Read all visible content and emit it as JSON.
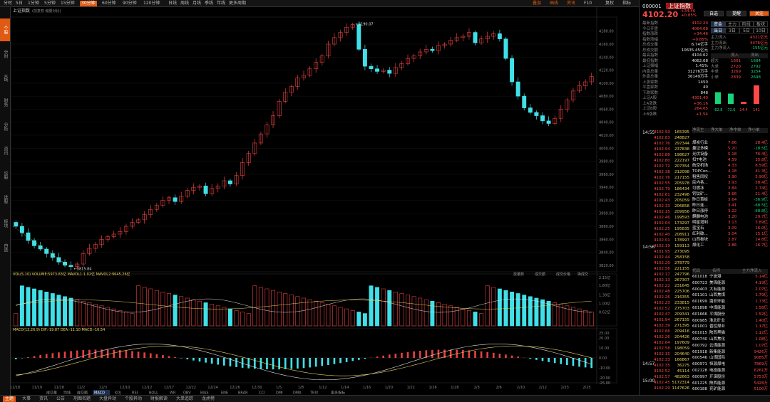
{
  "periods": [
    "分时",
    "5日",
    "1分钟",
    "5分钟",
    "15分钟",
    "30分钟",
    "60分钟",
    "90分钟",
    "120分钟",
    "日线",
    "周线",
    "月线",
    "季线",
    "年线",
    "更多周期"
  ],
  "period_active": 5,
  "toolbar_right": [
    "叠加",
    "画线",
    "资讯",
    "F10",
    "复权",
    "指标",
    "工具"
  ],
  "left_tabs": [
    "个股",
    "分时",
    "K线",
    "财务",
    "分析",
    "资讯",
    "论股",
    "选股",
    "板块",
    "自选"
  ],
  "chart": {
    "title": "上证指数",
    "legend": "(前复权 缩量对比)",
    "high_label": "4190.07",
    "low_label": "3815.84",
    "price_ticks": [
      "4180.00",
      "4160.00",
      "4140.00",
      "4120.00",
      "4100.00",
      "4080.00",
      "4060.00",
      "4040.00",
      "4020.00",
      "4000.00",
      "3980.00",
      "3960.00",
      "3940.00",
      "3920.00",
      "3900.00",
      "3880.00",
      "3860.00",
      "3840.00",
      "3820.00"
    ],
    "vol_legend": "VOL(5,10) VOLUME:5973.83亿 MAVOL1:1.02亿 MAVOL2:9645.26亿",
    "vol_ticks": [
      "2.15亿",
      "1.80亿",
      "1.38亿",
      "1.00亿",
      "0.62亿"
    ],
    "macd_legend": "MACD(12,26,9) DIF:-19.87 DEA:-11.10 MACD:-16.54",
    "macd_ticks": [
      "25.00",
      "20.00",
      "10.00",
      "0.00",
      "-10.00",
      "-20.00",
      "-25.00"
    ],
    "date_ticks": [
      "11/18",
      "11/19",
      "11/28",
      "12/2",
      "12/3",
      "12/10",
      "12/12",
      "12/17",
      "12/22",
      "12/24",
      "12/26",
      "12/30",
      "1/5",
      "1/8",
      "1/12",
      "1/14",
      "1/16",
      "1/20",
      "1/22",
      "1/26",
      "1/28",
      "2/3",
      "2/6",
      "2/10",
      "2/12",
      "2/23",
      "2/25"
    ],
    "vol_buttons": [
      "放量数",
      "成交额",
      "成交价格",
      "换成交"
    ]
  },
  "chart_data": {
    "type": "line",
    "title": "上证指数",
    "ylim": [
      3810,
      4195
    ],
    "high": 4190.07,
    "low": 3815.84,
    "close": [
      3880,
      3870,
      3858,
      3850,
      3845,
      3838,
      3832,
      3825,
      3820,
      3818,
      3822,
      3838,
      3846,
      3852,
      3860,
      3864,
      3868,
      3872,
      3880,
      3886,
      3890,
      3898,
      3906,
      3912,
      3920,
      3924,
      3918,
      3926,
      3935,
      3940,
      3942,
      3930,
      3938,
      3942,
      3950,
      3945,
      3958,
      3978,
      3992,
      4008,
      4022,
      4036,
      4050,
      4072,
      4086,
      4095,
      4108,
      4112,
      4122,
      4132,
      4142,
      4160,
      4170,
      4178,
      4186,
      4190,
      4152,
      4126,
      4122,
      4118,
      4120,
      4115,
      4124,
      4130,
      4138,
      4142,
      4148,
      4152,
      4150,
      4158,
      4160,
      4166,
      4170,
      4172,
      4178,
      4162,
      4168,
      4172,
      4176,
      4168,
      4138,
      4102,
      4080,
      4062,
      4055,
      4050,
      4042,
      4038,
      4046,
      4060,
      4074,
      4088,
      4096,
      4102,
      4110
    ]
  },
  "quote": {
    "code": "000001",
    "name": "上证指数",
    "price": "4102.20",
    "change": "+34.46",
    "pct": "+0.85%",
    "buttons": [
      "自选",
      "提醒",
      "关注"
    ],
    "stats": [
      [
        "最新指数",
        "4102.20"
      ],
      [
        "今日开盘",
        "4064.68"
      ],
      [
        "指数涨跌",
        "+34.46"
      ],
      [
        "指数涨幅",
        "+0.85%"
      ],
      [
        "总成交量",
        "6.74亿手"
      ],
      [
        "总成交额",
        "10635.45亿元"
      ],
      [
        "最高指数",
        "4104.62"
      ],
      [
        "最低指数",
        "4062.68"
      ],
      [
        "上证振幅",
        "1.41%"
      ],
      [
        "内盘总量",
        "31276万手"
      ],
      [
        "外盘总量",
        "36149万手"
      ],
      [
        "上涨家数",
        "1450"
      ],
      [
        "平盘家数",
        "40"
      ],
      [
        "下跌家数",
        "848"
      ],
      [
        "上证A股",
        "4301.40"
      ],
      [
        "上A涨跌",
        "+36.16"
      ],
      [
        "上证B股",
        "264.65"
      ],
      [
        "上B涨跌",
        "+1.54"
      ]
    ],
    "fund_tabs": [
      "资金",
      "主力",
      "阶段",
      "板块"
    ],
    "fund_sub": [
      "当日",
      "3日",
      "5日",
      "10日"
    ],
    "fund_rows": [
      [
        "主力流入",
        "4321亿元"
      ],
      [
        "主力流出",
        "4476亿元"
      ],
      [
        "主力净流入",
        "-155亿元"
      ]
    ],
    "inout_head": [
      "",
      "流入",
      "流出"
    ],
    "inout_rows": [
      [
        "超大",
        "1601",
        "1684"
      ],
      [
        "大单",
        "2720",
        "2792"
      ],
      [
        "中单",
        "3269",
        "3254"
      ],
      [
        "小单",
        "2839",
        "2698"
      ]
    ],
    "bars": [
      "-82.8",
      "-72.6",
      "14.4",
      "141"
    ]
  },
  "trades": {
    "header": "14:55",
    "rows": [
      [
        "4102.93",
        "165395"
      ],
      [
        "4102.83",
        "248827"
      ],
      [
        "4102.76",
        "297344"
      ],
      [
        "4102.94",
        "237838"
      ],
      [
        "4102.88",
        "198627"
      ],
      [
        "4102.80",
        "222197"
      ],
      [
        "4102.72",
        "207354"
      ],
      [
        "4102.38",
        "212098"
      ],
      [
        "4102.76",
        "217155"
      ],
      [
        "4102.55",
        "205978"
      ],
      [
        "4102.79",
        "186434"
      ],
      [
        "4102.61",
        "232498"
      ],
      [
        "4102.43",
        "205059"
      ],
      [
        "4102.33",
        "206858"
      ],
      [
        "4102.15",
        "209956"
      ],
      [
        "4102.46",
        "199593"
      ],
      [
        "4102.04",
        "173297"
      ],
      [
        "4102.25",
        "195835"
      ],
      [
        "4102.40",
        "208911"
      ],
      [
        "4102.01",
        "178997"
      ],
      [
        "4102.19",
        "159113"
      ],
      [
        "4101.95",
        "273095"
      ],
      [
        "4102.44",
        "258158"
      ],
      [
        "4102.29",
        "278779"
      ],
      [
        "4102.58",
        "221155"
      ],
      [
        "4102.17",
        "247796"
      ],
      [
        "4102.13",
        "267307"
      ],
      [
        "4102.22",
        "231645"
      ],
      [
        "4102.48",
        "225706"
      ],
      [
        "4102.26",
        "216355"
      ],
      [
        "4102.23",
        "233815"
      ],
      [
        "4102.52",
        "275703"
      ],
      [
        "4102.47",
        "209341"
      ],
      [
        "4101.94",
        "267155"
      ],
      [
        "4102.39",
        "271395"
      ],
      [
        "4102.66",
        "209416"
      ],
      [
        "4102.26",
        "204426"
      ],
      [
        "4102.64",
        "197609"
      ],
      [
        "4102.58",
        "198059"
      ],
      [
        "4102.15",
        "204640"
      ],
      [
        "4102.33",
        "166867"
      ],
      [
        "4102.35",
        "36275"
      ],
      [
        "4102.52",
        "45114"
      ],
      [
        "4102.57",
        "482663"
      ],
      [
        "4102.45",
        "5172314"
      ],
      [
        "4102.29",
        "1147626"
      ]
    ],
    "mid_time": "14:56",
    "end_time": "14:57",
    "last_time": "15:00"
  },
  "sectors": {
    "head": [
      "净流主",
      "净大单",
      "净中单",
      "净小单"
    ],
    "rows": [
      [
        "煤炭行业",
        "7.66",
        "28.4亿"
      ],
      [
        "量证多模",
        "5.20",
        "-18.5亿"
      ],
      [
        "光伏设备",
        "5.18",
        "76.4亿"
      ],
      [
        "扣T电池",
        "4.59",
        "35.8亿"
      ],
      [
        "航空机场",
        "4.33",
        "8.59亿"
      ],
      [
        "TOPCon...",
        "4.18",
        "41.3亿"
      ],
      [
        "租售同权",
        "3.90",
        "5.90亿"
      ],
      [
        "民内各...",
        "3.93",
        "58.4亿"
      ],
      [
        "可燃冰",
        "3.84",
        "2.74亿"
      ],
      [
        "钙钛矿...",
        "3.66",
        "21.4亿"
      ],
      [
        "昨日首板",
        "3.64",
        "-36.9亿"
      ],
      [
        "昨日连...",
        "3.41",
        "-68.5亿"
      ],
      [
        "昨日涨停",
        "3.22",
        "-68.8亿"
      ],
      [
        "麒麟电池",
        "3.20",
        "29.7亿"
      ],
      [
        "明星增利",
        "3.13",
        "3.89亿"
      ],
      [
        "蓝宝石",
        "3.09",
        "16.0亿"
      ],
      [
        "红利破...",
        "3.04",
        "15.1亿"
      ],
      [
        "山西板块",
        "2.87",
        "14.8亿"
      ],
      [
        "煤化工",
        "2.86",
        "16.7亿"
      ]
    ]
  },
  "stocks": {
    "head": [
      "代码",
      "名称",
      "主力净流入"
    ],
    "rows": [
      [
        "601018",
        "宁波港",
        "5.14亿"
      ],
      [
        "600723",
        "美锦能源",
        "4.19亿"
      ],
      [
        "600403",
        "大有能源",
        "2.07亿"
      ],
      [
        "601101",
        "山西焦煤",
        "1.79亿"
      ],
      [
        "601699",
        "潞安环能",
        "1.73亿"
      ],
      [
        "601898",
        "中煤能源",
        "1.58亿"
      ],
      [
        "601666",
        "平煤股份",
        "1.52亿"
      ],
      [
        "600985",
        "淮北矿业",
        "1.40亿"
      ],
      [
        "601001",
        "晋控煤业",
        "1.17亿"
      ],
      [
        "601015",
        "陕西黑猫",
        "1.12亿"
      ],
      [
        "600740",
        "山西焦化",
        "1.08亿"
      ],
      [
        "600792",
        "云煤能源",
        "1.07亿"
      ],
      [
        "601918",
        "新集能源",
        "9426万"
      ],
      [
        "600546",
        "山煤国际",
        "9085万"
      ],
      [
        "600971",
        "恒源煤电",
        "7869万"
      ],
      [
        "002128",
        "电投能源",
        "6261万"
      ],
      [
        "600997",
        "开滦股份",
        "5753万"
      ],
      [
        "601225",
        "陕西能源",
        "5428万"
      ],
      [
        "600188",
        "兖矿能源",
        "5100万"
      ]
    ]
  },
  "right_bottom_tabs": [
    "分笔",
    "分价",
    "A股",
    "财务"
  ],
  "bottom_tabs": [
    "主题",
    "大事",
    "资讯",
    "公告",
    "刑图名题",
    "大盘异动",
    "个股异动",
    "财报解读",
    "大单追踪",
    "龙虎榜"
  ],
  "bottom_indicators": [
    "成交量",
    "均线",
    "成交额",
    "MACD",
    "KDJ",
    "RSI",
    "BOLL",
    "WR",
    "OBV",
    "BIAS",
    "ENE",
    "BRAR",
    "CCI",
    "DMI",
    "DMA",
    "TRIX",
    "更多指标"
  ],
  "indicator_active": "MACD"
}
